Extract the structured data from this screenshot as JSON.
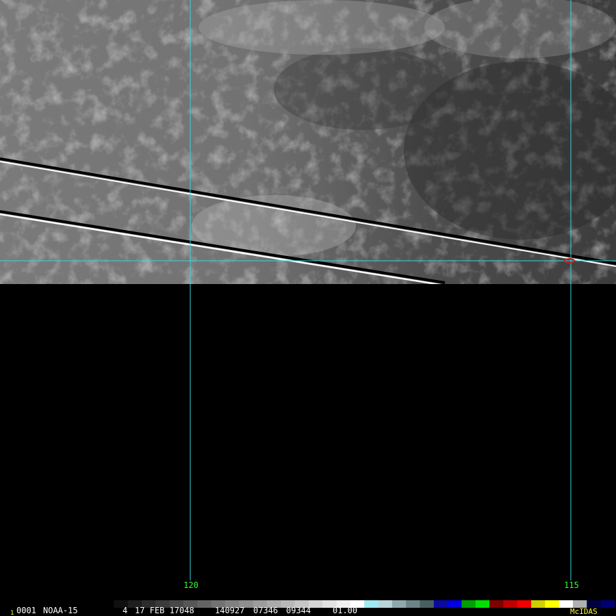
{
  "frame": {
    "number": "1",
    "id": "0001",
    "satellite": "NOAA-15",
    "band": "4",
    "date": "17 FEB 17048",
    "time": "140927",
    "line": "07346",
    "element": "09344",
    "resolution": "01.00"
  },
  "longitude_labels": [
    "120",
    "115"
  ],
  "brand": "McIDAS",
  "colors": {
    "grid": "#35d6e0",
    "label": "#33ff33",
    "brand": "#ffff33",
    "text": "#ffffff",
    "marker": "#c02020"
  },
  "colorbar": {
    "segments": [
      "#000000",
      "#101010",
      "#1e1e1e",
      "#2c2c2c",
      "#3a3a3a",
      "#484848",
      "#565656",
      "#646464",
      "#727272",
      "#808080",
      "#8e8e8e",
      "#9c9c9c",
      "#aaaaaa",
      "#b8b8b8",
      "#c6c6c6",
      "#d4d4d4",
      "#e2e2e2",
      "#f0f0f0",
      "#ffffff",
      "#9ee8f0",
      "#b8d4d8",
      "#90a8ac",
      "#6d8388",
      "#4a5e62",
      "#0a0aa0",
      "#0000e0",
      "#00a000",
      "#00e000",
      "#800000",
      "#c00000",
      "#f00000",
      "#d0d000",
      "#ffff00",
      "#ffffff",
      "#b0b0b0",
      "#000040",
      "#000070"
    ]
  }
}
